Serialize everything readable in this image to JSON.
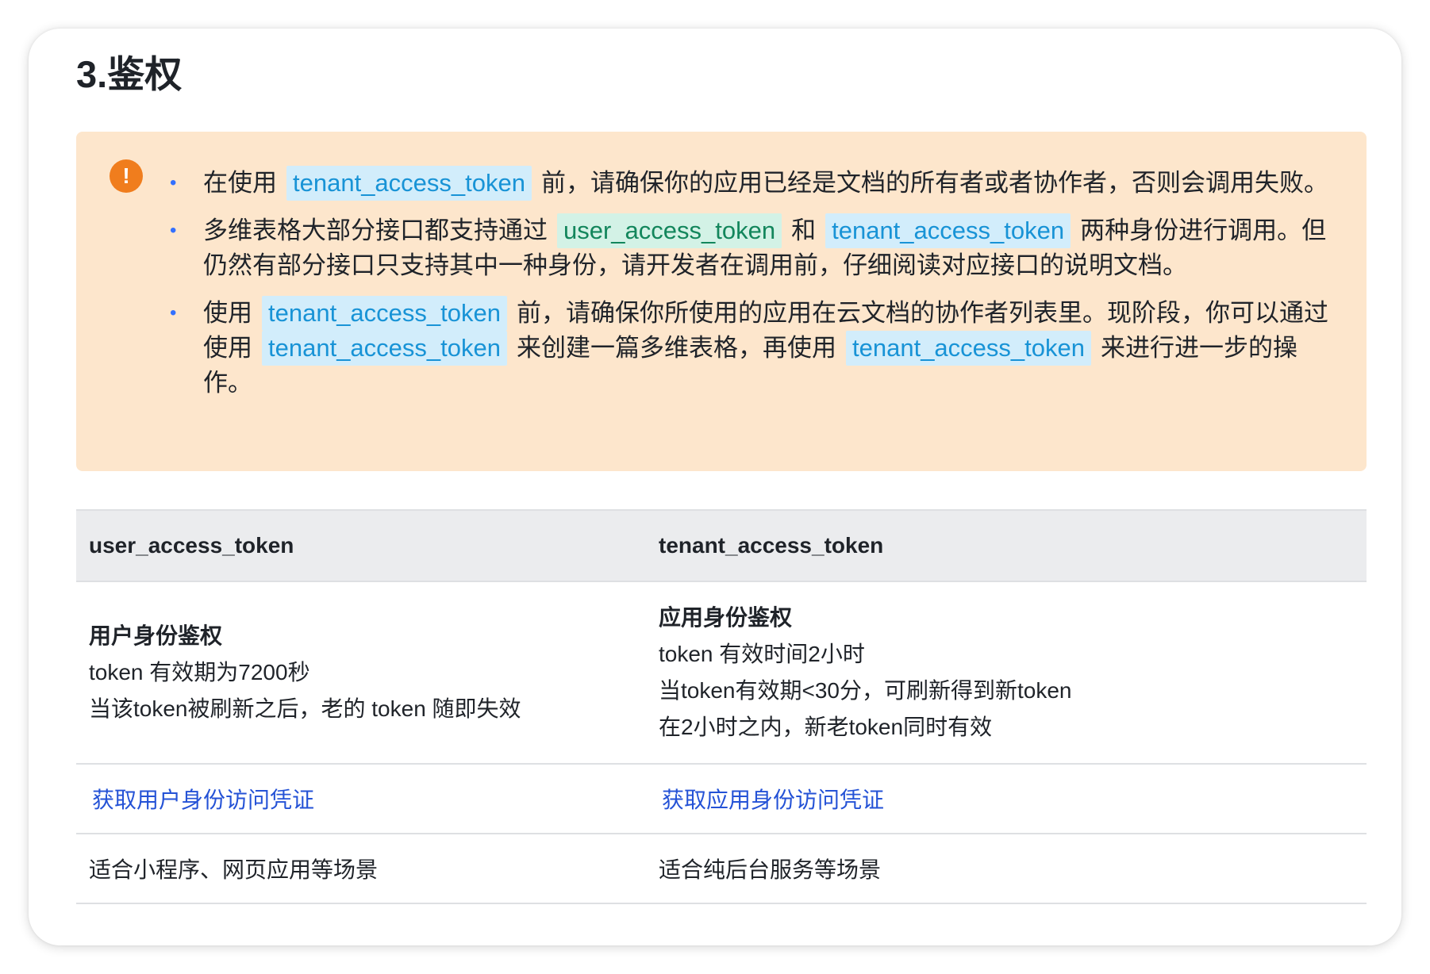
{
  "title": "3.鉴权",
  "callout": {
    "icon": "exclamation-circle-icon",
    "items": [
      {
        "pre": "在使用",
        "code1": "tenant_access_token",
        "post": "前，请确保你的应用已经是文档的所有者或者协作者，否则会调用失败。"
      },
      {
        "pre": "多维表格大部分接口都支持通过",
        "code1": "user_access_token",
        "mid": "和",
        "code2": "tenant_access_token",
        "post": "两种身份进行调用。但仍然有部分接口只支持其中一种身份，请开发者在调用前，仔细阅读对应接口的说明文档。"
      },
      {
        "pre": "使用",
        "code1": "tenant_access_token",
        "mid1": "前，请确保你所使用的应用在云文档的协作者列表里。现阶段，你可以通过使用",
        "code2": "tenant_access_token",
        "mid2": "来创建一篇多维表格，再使用",
        "code3": "tenant_access_token",
        "post": "来进行进一步的操作。"
      }
    ]
  },
  "table": {
    "headers": [
      "user_access_token",
      "tenant_access_token"
    ],
    "user": {
      "title": "用户身份鉴权",
      "lines": [
        "token 有效期为7200秒",
        "当该token被刷新之后，老的 token 随即失效"
      ],
      "link": "获取用户身份访问凭证",
      "scene": "适合小程序、网页应用等场景"
    },
    "tenant": {
      "title": "应用身份鉴权",
      "lines": [
        "token 有效时间2小时",
        "当token有效期<30分，可刷新得到新token",
        "在2小时之内，新老token同时有效"
      ],
      "link": "获取应用身份访问凭证",
      "scene": "适合纯后台服务等场景"
    }
  },
  "colors": {
    "callout_bg": "#fde6cc",
    "warn_icon": "#f07d1d",
    "tenant_code": "#1893d6",
    "user_code": "#13865c",
    "link": "#2452d6"
  }
}
